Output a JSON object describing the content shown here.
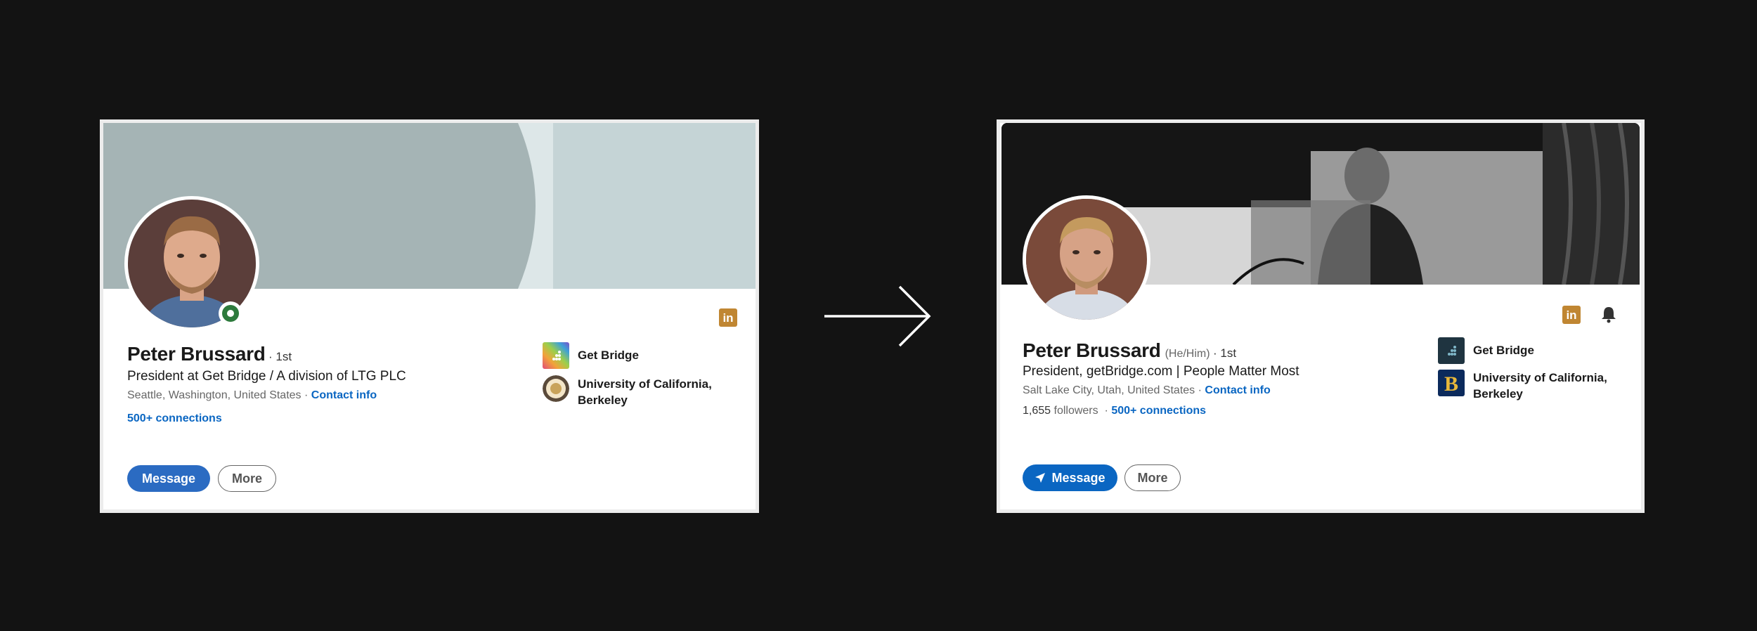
{
  "before": {
    "name": "Peter Brussard",
    "degree": "· 1st",
    "headline": "President at Get Bridge / A division of LTG PLC",
    "location": "Seattle, Washington, United States ·",
    "contact": "Contact info",
    "connections": "500+ connections",
    "message": "Message",
    "more": "More",
    "orgs": [
      {
        "name": "Get Bridge",
        "logo": "rainbow-gradient-logo"
      },
      {
        "name": "University of California, Berkeley",
        "logo": "round-seal-logo"
      }
    ],
    "icons": [
      "linkedin-icon"
    ]
  },
  "after": {
    "name": "Peter Brussard",
    "pronouns": "(He/Him)",
    "degree": "· 1st",
    "headline": "President, getBridge.com | People Matter Most",
    "location": "Salt Lake City, Utah, United States ·",
    "contact": "Contact info",
    "followers_count": "1,655",
    "followers_label": "followers",
    "separator": "·",
    "connections": "500+ connections",
    "message": "Message",
    "more": "More",
    "orgs": [
      {
        "name": "Get Bridge",
        "logo": "dark-navy-dots-logo"
      },
      {
        "name": "University of California, Berkeley",
        "logo": "berkeley-b-logo"
      }
    ],
    "icons": [
      "linkedin-icon",
      "bell-icon",
      "send-icon"
    ]
  },
  "colors": {
    "accent": "#0a66c2",
    "page_background": "#131313",
    "linkedin_icon": "#c08632"
  }
}
